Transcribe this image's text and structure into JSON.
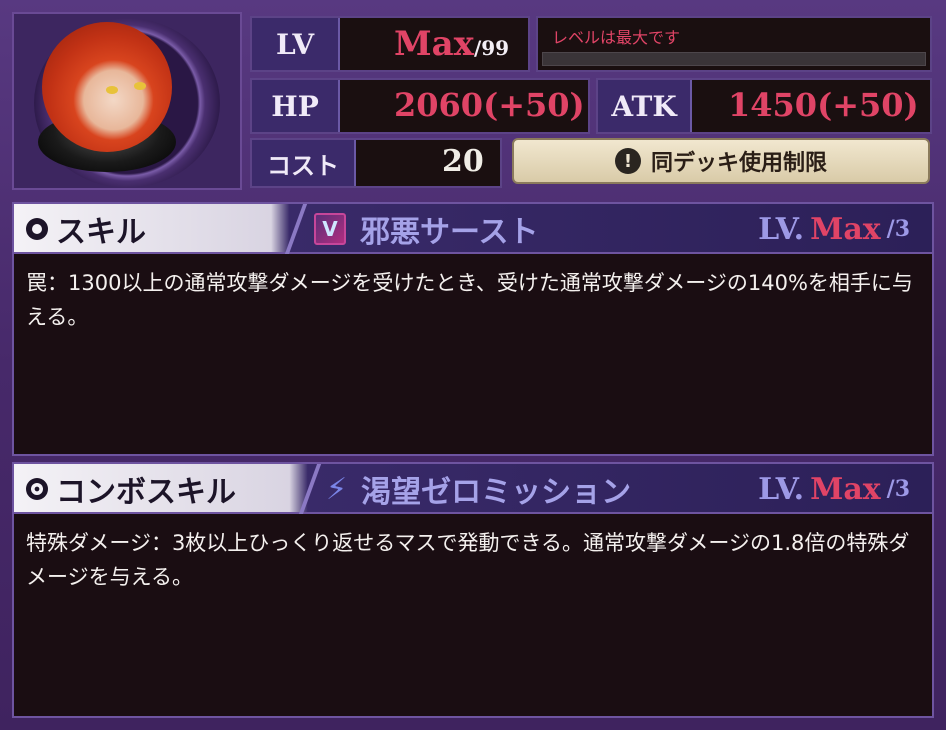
{
  "stats": {
    "level": {
      "label": "LV",
      "value": "Max",
      "max": "/99",
      "note": "レベルは最大です"
    },
    "hp": {
      "label": "HP",
      "value": "2060(+50)"
    },
    "atk": {
      "label": "ATK",
      "value": "1450(+50)"
    },
    "cost": {
      "label": "コスト",
      "value": "20"
    },
    "deck_limit_label": "同デッキ使用制限"
  },
  "skill": {
    "section_title": "スキル",
    "name": "邪悪サースト",
    "lv_label": "LV.",
    "lv_value": "Max",
    "lv_max": "/3",
    "description": "罠：1300以上の通常攻撃ダメージを受けたとき、受けた通常攻撃ダメージの140%を相手に与える。"
  },
  "combo_skill": {
    "section_title": "コンボスキル",
    "name": "渇望ゼロミッション",
    "lv_label": "LV.",
    "lv_value": "Max",
    "lv_max": "/3",
    "description": "特殊ダメージ：3枚以上ひっくり返せるマスで発動できる。通常攻撃ダメージの1.8倍の特殊ダメージを与える。"
  },
  "icons": {
    "portrait": "character-portrait",
    "deck_limit": "exclamation-icon",
    "skill": "trap-icon",
    "combo": "lightning-icon"
  },
  "colors": {
    "frame": "#4a2d6b",
    "value_red": "#e04466",
    "skill_name": "#a5a2e8"
  }
}
